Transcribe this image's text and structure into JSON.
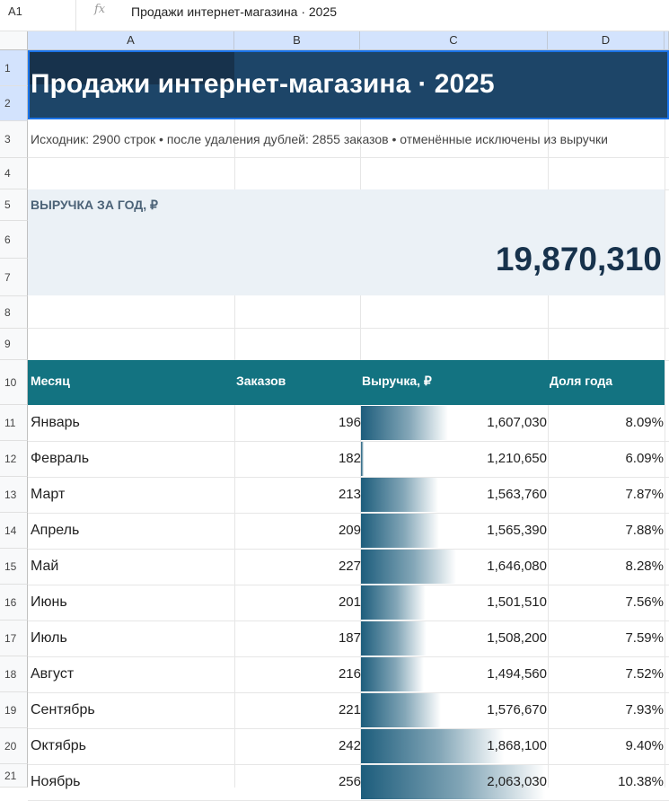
{
  "formula_bar": {
    "cell_ref": "A1",
    "fx_icon": "fx",
    "formula": "Продажи интернет-магазина · 2025"
  },
  "columns": [
    "A",
    "B",
    "C",
    "D"
  ],
  "rows": [
    "1",
    "2",
    "3",
    "4",
    "5",
    "6",
    "7",
    "8",
    "9",
    "10",
    "11",
    "12",
    "13",
    "14",
    "15",
    "16",
    "17",
    "18",
    "19",
    "20",
    "21"
  ],
  "title": "Продажи интернет-магазина · 2025",
  "note": "Исходник: 2900 строк • после удаления дублей: 2855 заказов • отменённые исключены из выручки",
  "kpi": {
    "label": "ВЫРУЧКА ЗА ГОД, ₽",
    "value": "19,870,310"
  },
  "table": {
    "headers": {
      "month": "Месяц",
      "orders": "Заказов",
      "revenue": "Выручка, ₽",
      "share": "Доля года"
    },
    "bar_max": 2063030,
    "bar_color": "#1d5d7c",
    "rows": [
      {
        "month": "Январь",
        "orders": "196",
        "revenue": "1,607,030",
        "revenue_value": 1607030,
        "share": "8.09%"
      },
      {
        "month": "Февраль",
        "orders": "182",
        "revenue": "1,210,650",
        "revenue_value": 1210650,
        "share": "6.09%"
      },
      {
        "month": "Март",
        "orders": "213",
        "revenue": "1,563,760",
        "revenue_value": 1563760,
        "share": "7.87%"
      },
      {
        "month": "Апрель",
        "orders": "209",
        "revenue": "1,565,390",
        "revenue_value": 1565390,
        "share": "7.88%"
      },
      {
        "month": "Май",
        "orders": "227",
        "revenue": "1,646,080",
        "revenue_value": 1646080,
        "share": "8.28%"
      },
      {
        "month": "Июнь",
        "orders": "201",
        "revenue": "1,501,510",
        "revenue_value": 1501510,
        "share": "7.56%"
      },
      {
        "month": "Июль",
        "orders": "187",
        "revenue": "1,508,200",
        "revenue_value": 1508200,
        "share": "7.59%"
      },
      {
        "month": "Август",
        "orders": "216",
        "revenue": "1,494,560",
        "revenue_value": 1494560,
        "share": "7.52%"
      },
      {
        "month": "Сентябрь",
        "orders": "221",
        "revenue": "1,576,670",
        "revenue_value": 1576670,
        "share": "7.93%"
      },
      {
        "month": "Октябрь",
        "orders": "242",
        "revenue": "1,868,100",
        "revenue_value": 1868100,
        "share": "9.40%"
      },
      {
        "month": "Ноябрь",
        "orders": "256",
        "revenue": "2,063,030",
        "revenue_value": 2063030,
        "share": "10.38%"
      }
    ]
  }
}
